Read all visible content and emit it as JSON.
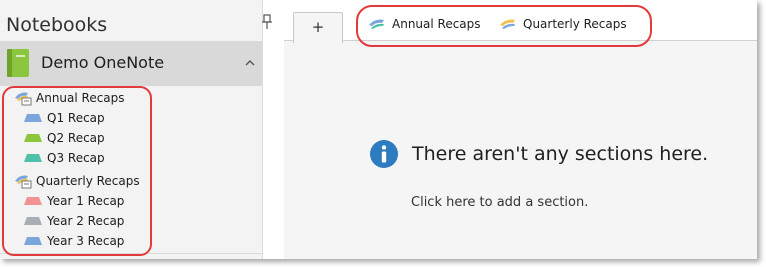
{
  "sidebar": {
    "title": "Notebooks",
    "notebook": {
      "name": "Demo OneNote",
      "color": "#8cc63f"
    },
    "groups": [
      {
        "label": "Annual Recaps",
        "sections": [
          {
            "label": "Q1 Recap",
            "color": "#7aa6db"
          },
          {
            "label": "Q2 Recap",
            "color": "#8cc63f"
          },
          {
            "label": "Q3 Recap",
            "color": "#4fc1a8"
          }
        ]
      },
      {
        "label": "Quarterly Recaps",
        "sections": [
          {
            "label": "Year 1 Recap",
            "color": "#f29393"
          },
          {
            "label": "Year 2 Recap",
            "color": "#a7aeb6"
          },
          {
            "label": "Year 3 Recap",
            "color": "#7aa6db"
          }
        ]
      }
    ]
  },
  "tabbar": {
    "add_label": "+",
    "groups": [
      "Annual Recaps",
      "Quarterly Recaps"
    ]
  },
  "main": {
    "empty_message": "There aren't any sections here.",
    "add_section_link": "Click here to add a section."
  },
  "colors": {
    "highlight": "#e23a3a",
    "info": "#2e7bbf"
  }
}
